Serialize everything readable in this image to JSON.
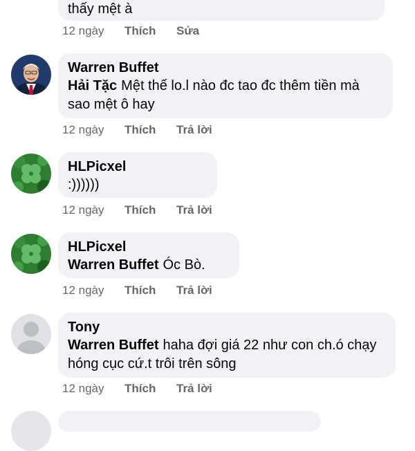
{
  "comments": [
    {
      "text": "thấy mệt à",
      "time": "12 ngày",
      "like": "Thích",
      "action": "Sửa"
    },
    {
      "author": "Warren Buffet",
      "mention": "Hải Tặc",
      "text": "Mệt thế lo.l nào đc tao đc thêm tiền mà sao mệt ô hay",
      "time": "12 ngày",
      "like": "Thích",
      "action": "Trả lời"
    },
    {
      "author": "HLPicxel",
      "text": ":))))))",
      "time": "12 ngày",
      "like": "Thích",
      "action": "Trả lời"
    },
    {
      "author": "HLPicxel",
      "mention": "Warren Buffet",
      "text": "Óc Bò.",
      "time": "12 ngày",
      "like": "Thích",
      "action": "Trả lời"
    },
    {
      "author": "Tony",
      "mention": "Warren Buffet",
      "text": "haha đợi giá 22 như con ch.ó chạy hóng cục cứ.t trôi trên sông",
      "time": "12 ngày",
      "like": "Thích",
      "action": "Trả lời"
    }
  ]
}
